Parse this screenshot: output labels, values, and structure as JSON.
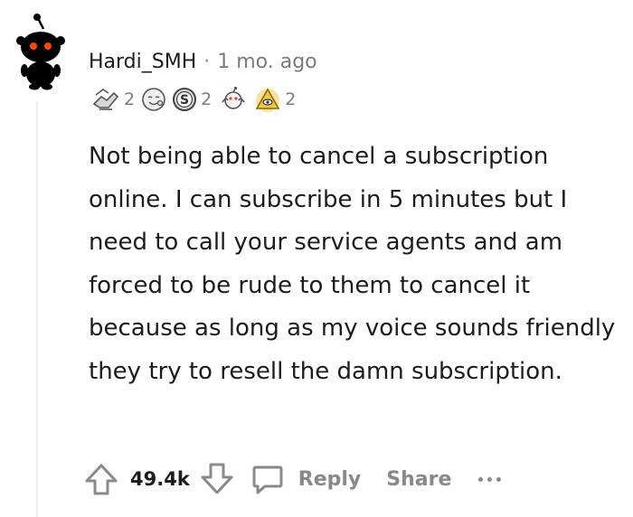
{
  "comment": {
    "username": "Hardi_SMH",
    "separator": "·",
    "timestamp": "1 mo. ago",
    "awards": [
      {
        "icon": "helping-hand-award-icon",
        "count": "2"
      },
      {
        "icon": "wholesome-award-icon",
        "count": ""
      },
      {
        "icon": "silver-award-icon",
        "count": "2"
      },
      {
        "icon": "hugz-award-icon",
        "count": ""
      },
      {
        "icon": "illuminati-award-icon",
        "count": "2"
      }
    ],
    "body": "Not being able to cancel a subscription online. I can subscribe in 5 minutes but I need to call your service agents and am forced to be rude to them to cancel it because as long as my voice sounds friendly they try to resell the damn subscription.",
    "votes": "49.4k",
    "reply_label": "Reply",
    "share_label": "Share",
    "more_label": "more-options"
  },
  "colors": {
    "text": "#1c1c1c",
    "muted": "#878a8c",
    "thread_line": "#edeff1",
    "avatar_red": "#ff4500",
    "award_gold": "#f2c94c"
  }
}
